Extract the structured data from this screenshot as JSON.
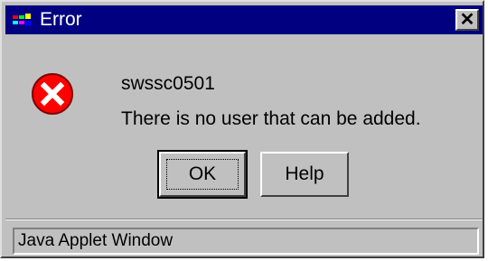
{
  "window": {
    "title": "Error",
    "close_glyph": "✕"
  },
  "message": {
    "code": "swssc0501",
    "text": "There is no user that can be added."
  },
  "buttons": {
    "ok_label": "OK",
    "help_label": "Help"
  },
  "status_bar": {
    "text": "Java Applet Window"
  },
  "icons": {
    "app": "java-app-icon",
    "error": "error-icon",
    "close": "close-icon"
  },
  "colors": {
    "titlebar": "#000080",
    "window_bg": "#c0c0c0",
    "error_red": "#ff0000"
  }
}
